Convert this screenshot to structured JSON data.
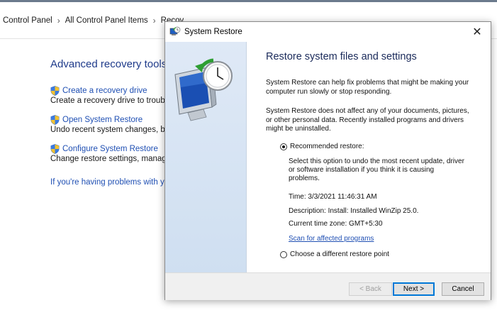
{
  "background": {
    "breadcrumb": [
      "Control Panel",
      "All Control Panel Items",
      "Recov"
    ],
    "title": "Advanced recovery tools",
    "items": [
      {
        "link": "Create a recovery drive",
        "desc": "Create a recovery drive to troublest"
      },
      {
        "link": "Open System Restore",
        "desc": "Undo recent system changes, but le"
      },
      {
        "link": "Configure System Restore",
        "desc": "Change restore settings, manage di"
      }
    ],
    "help_link": "If you're having problems with your"
  },
  "dialog": {
    "title": "System Restore",
    "close_glyph": "✕",
    "heading": "Restore system files and settings",
    "para1": "System Restore can help fix problems that might be making your computer run slowly or stop responding.",
    "para2": "System Restore does not affect any of your documents, pictures, or other personal data. Recently installed programs and drivers might be uninstalled.",
    "recommended_label": "Recommended restore:",
    "recommended_desc": [
      "Select this option to undo the most recent update, driver",
      "or software installation if you think it is causing",
      "problems."
    ],
    "time": "Time: 3/3/2021 11:46:31 AM",
    "description": "Description: Install: Installed WinZip 25.0.",
    "timezone": "Current time zone: GMT+5:30",
    "scan_link": "Scan for affected programs",
    "different_label": "Choose a different restore point",
    "back_label": "< Back",
    "next_label": "Next >",
    "cancel_label": "Cancel"
  },
  "icons": [
    "shield-icon",
    "system-restore-icon",
    "close-icon"
  ]
}
